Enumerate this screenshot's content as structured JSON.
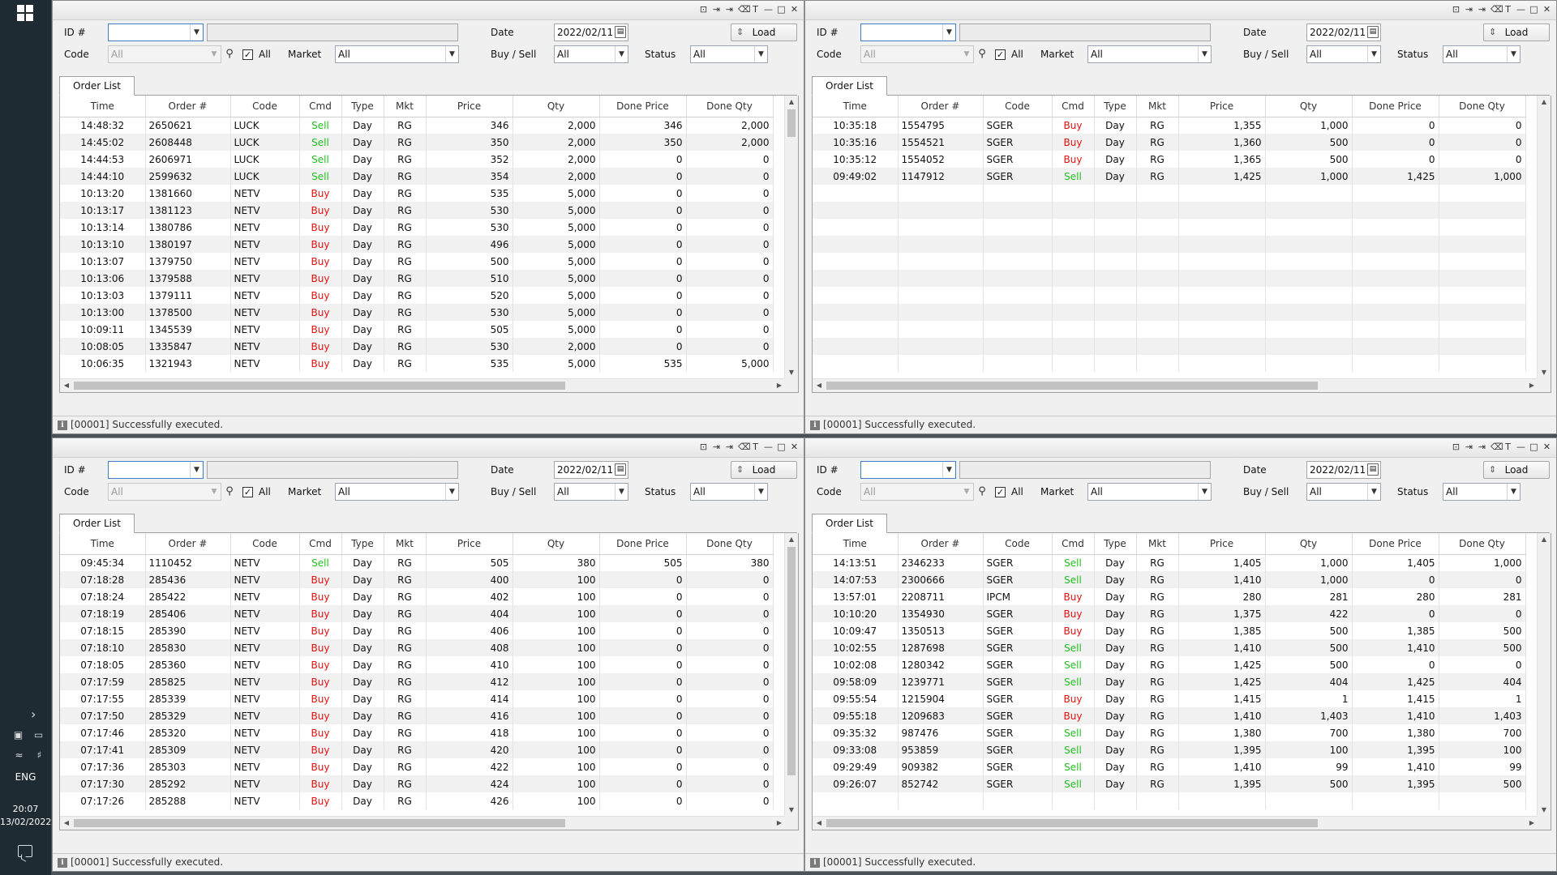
{
  "taskbar": {
    "lang": "ENG",
    "time": "20:07",
    "date": "13/02/2022"
  },
  "labels": {
    "id": "ID #",
    "code": "Code",
    "all_check": "All",
    "market": "Market",
    "date": "Date",
    "buysell": "Buy / Sell",
    "status": "Status",
    "load": "Load",
    "tab": "Order List",
    "headers": [
      "Time",
      "Order #",
      "Code",
      "Cmd",
      "Type",
      "Mkt",
      "Price",
      "Qty",
      "Done Price",
      "Done Qty"
    ]
  },
  "panels": [
    {
      "date": "2022/02/11",
      "code": "All",
      "market": "All",
      "buysell": "All",
      "status": "All",
      "status_msg": "[00001] Successfully executed.",
      "rows": [
        [
          "14:48:32",
          "2650621",
          "LUCK",
          "Sell",
          "Day",
          "RG",
          "346",
          "2,000",
          "346",
          "2,000"
        ],
        [
          "14:45:02",
          "2608448",
          "LUCK",
          "Sell",
          "Day",
          "RG",
          "350",
          "2,000",
          "350",
          "2,000"
        ],
        [
          "14:44:53",
          "2606971",
          "LUCK",
          "Sell",
          "Day",
          "RG",
          "352",
          "2,000",
          "0",
          "0"
        ],
        [
          "14:44:10",
          "2599632",
          "LUCK",
          "Sell",
          "Day",
          "RG",
          "354",
          "2,000",
          "0",
          "0"
        ],
        [
          "10:13:20",
          "1381660",
          "NETV",
          "Buy",
          "Day",
          "RG",
          "535",
          "5,000",
          "0",
          "0"
        ],
        [
          "10:13:17",
          "1381123",
          "NETV",
          "Buy",
          "Day",
          "RG",
          "530",
          "5,000",
          "0",
          "0"
        ],
        [
          "10:13:14",
          "1380786",
          "NETV",
          "Buy",
          "Day",
          "RG",
          "530",
          "5,000",
          "0",
          "0"
        ],
        [
          "10:13:10",
          "1380197",
          "NETV",
          "Buy",
          "Day",
          "RG",
          "496",
          "5,000",
          "0",
          "0"
        ],
        [
          "10:13:07",
          "1379750",
          "NETV",
          "Buy",
          "Day",
          "RG",
          "500",
          "5,000",
          "0",
          "0"
        ],
        [
          "10:13:06",
          "1379588",
          "NETV",
          "Buy",
          "Day",
          "RG",
          "510",
          "5,000",
          "0",
          "0"
        ],
        [
          "10:13:03",
          "1379111",
          "NETV",
          "Buy",
          "Day",
          "RG",
          "520",
          "5,000",
          "0",
          "0"
        ],
        [
          "10:13:00",
          "1378500",
          "NETV",
          "Buy",
          "Day",
          "RG",
          "530",
          "5,000",
          "0",
          "0"
        ],
        [
          "10:09:11",
          "1345539",
          "NETV",
          "Buy",
          "Day",
          "RG",
          "505",
          "5,000",
          "0",
          "0"
        ],
        [
          "10:08:05",
          "1335847",
          "NETV",
          "Buy",
          "Day",
          "RG",
          "530",
          "2,000",
          "0",
          "0"
        ],
        [
          "10:06:35",
          "1321943",
          "NETV",
          "Buy",
          "Day",
          "RG",
          "535",
          "5,000",
          "535",
          "5,000"
        ]
      ]
    },
    {
      "date": "2022/02/11",
      "code": "All",
      "market": "All",
      "buysell": "All",
      "status": "All",
      "status_msg": "[00001] Successfully executed.",
      "rows": [
        [
          "10:35:18",
          "1554795",
          "SGER",
          "Buy",
          "Day",
          "RG",
          "1,355",
          "1,000",
          "0",
          "0"
        ],
        [
          "10:35:16",
          "1554521",
          "SGER",
          "Buy",
          "Day",
          "RG",
          "1,360",
          "500",
          "0",
          "0"
        ],
        [
          "10:35:12",
          "1554052",
          "SGER",
          "Buy",
          "Day",
          "RG",
          "1,365",
          "500",
          "0",
          "0"
        ],
        [
          "09:49:02",
          "1147912",
          "SGER",
          "Sell",
          "Day",
          "RG",
          "1,425",
          "1,000",
          "1,425",
          "1,000"
        ]
      ]
    },
    {
      "date": "2022/02/11",
      "code": "All",
      "market": "All",
      "buysell": "All",
      "status": "All",
      "status_msg": "[00001] Successfully executed.",
      "rows": [
        [
          "09:45:34",
          "1110452",
          "NETV",
          "Sell",
          "Day",
          "RG",
          "505",
          "380",
          "505",
          "380"
        ],
        [
          "07:18:28",
          "285436",
          "NETV",
          "Buy",
          "Day",
          "RG",
          "400",
          "100",
          "0",
          "0"
        ],
        [
          "07:18:24",
          "285422",
          "NETV",
          "Buy",
          "Day",
          "RG",
          "402",
          "100",
          "0",
          "0"
        ],
        [
          "07:18:19",
          "285406",
          "NETV",
          "Buy",
          "Day",
          "RG",
          "404",
          "100",
          "0",
          "0"
        ],
        [
          "07:18:15",
          "285390",
          "NETV",
          "Buy",
          "Day",
          "RG",
          "406",
          "100",
          "0",
          "0"
        ],
        [
          "07:18:10",
          "285830",
          "NETV",
          "Buy",
          "Day",
          "RG",
          "408",
          "100",
          "0",
          "0"
        ],
        [
          "07:18:05",
          "285360",
          "NETV",
          "Buy",
          "Day",
          "RG",
          "410",
          "100",
          "0",
          "0"
        ],
        [
          "07:17:59",
          "285825",
          "NETV",
          "Buy",
          "Day",
          "RG",
          "412",
          "100",
          "0",
          "0"
        ],
        [
          "07:17:55",
          "285339",
          "NETV",
          "Buy",
          "Day",
          "RG",
          "414",
          "100",
          "0",
          "0"
        ],
        [
          "07:17:50",
          "285329",
          "NETV",
          "Buy",
          "Day",
          "RG",
          "416",
          "100",
          "0",
          "0"
        ],
        [
          "07:17:46",
          "285320",
          "NETV",
          "Buy",
          "Day",
          "RG",
          "418",
          "100",
          "0",
          "0"
        ],
        [
          "07:17:41",
          "285309",
          "NETV",
          "Buy",
          "Day",
          "RG",
          "420",
          "100",
          "0",
          "0"
        ],
        [
          "07:17:36",
          "285303",
          "NETV",
          "Buy",
          "Day",
          "RG",
          "422",
          "100",
          "0",
          "0"
        ],
        [
          "07:17:30",
          "285292",
          "NETV",
          "Buy",
          "Day",
          "RG",
          "424",
          "100",
          "0",
          "0"
        ],
        [
          "07:17:26",
          "285288",
          "NETV",
          "Buy",
          "Day",
          "RG",
          "426",
          "100",
          "0",
          "0"
        ]
      ]
    },
    {
      "date": "2022/02/11",
      "code": "All",
      "market": "All",
      "buysell": "All",
      "status": "All",
      "status_msg": "[00001] Successfully executed.",
      "rows": [
        [
          "14:13:51",
          "2346233",
          "SGER",
          "Sell",
          "Day",
          "RG",
          "1,405",
          "1,000",
          "1,405",
          "1,000"
        ],
        [
          "14:07:53",
          "2300666",
          "SGER",
          "Sell",
          "Day",
          "RG",
          "1,410",
          "1,000",
          "0",
          "0"
        ],
        [
          "13:57:01",
          "2208711",
          "IPCM",
          "Buy",
          "Day",
          "RG",
          "280",
          "281",
          "280",
          "281"
        ],
        [
          "10:10:20",
          "1354930",
          "SGER",
          "Buy",
          "Day",
          "RG",
          "1,375",
          "422",
          "0",
          "0"
        ],
        [
          "10:09:47",
          "1350513",
          "SGER",
          "Buy",
          "Day",
          "RG",
          "1,385",
          "500",
          "1,385",
          "500"
        ],
        [
          "10:02:55",
          "1287698",
          "SGER",
          "Sell",
          "Day",
          "RG",
          "1,410",
          "500",
          "1,410",
          "500"
        ],
        [
          "10:02:08",
          "1280342",
          "SGER",
          "Sell",
          "Day",
          "RG",
          "1,425",
          "500",
          "0",
          "0"
        ],
        [
          "09:58:09",
          "1239771",
          "SGER",
          "Sell",
          "Day",
          "RG",
          "1,425",
          "404",
          "1,425",
          "404"
        ],
        [
          "09:55:54",
          "1215904",
          "SGER",
          "Buy",
          "Day",
          "RG",
          "1,415",
          "1",
          "1,415",
          "1"
        ],
        [
          "09:55:18",
          "1209683",
          "SGER",
          "Buy",
          "Day",
          "RG",
          "1,410",
          "1,403",
          "1,410",
          "1,403"
        ],
        [
          "09:35:32",
          "987476",
          "SGER",
          "Sell",
          "Day",
          "RG",
          "1,380",
          "700",
          "1,380",
          "700"
        ],
        [
          "09:33:08",
          "953859",
          "SGER",
          "Sell",
          "Day",
          "RG",
          "1,395",
          "100",
          "1,395",
          "100"
        ],
        [
          "09:29:49",
          "909382",
          "SGER",
          "Sell",
          "Day",
          "RG",
          "1,410",
          "99",
          "1,410",
          "99"
        ],
        [
          "09:26:07",
          "852742",
          "SGER",
          "Sell",
          "Day",
          "RG",
          "1,395",
          "500",
          "1,395",
          "500"
        ]
      ]
    }
  ],
  "colors": {
    "buy": "#e01010",
    "sell": "#22c022"
  },
  "icons": [
    "windows-icon",
    "search-icon",
    "calendar-icon",
    "refresh-icon",
    "info-icon",
    "minimize-icon",
    "maximize-icon",
    "close-icon"
  ]
}
